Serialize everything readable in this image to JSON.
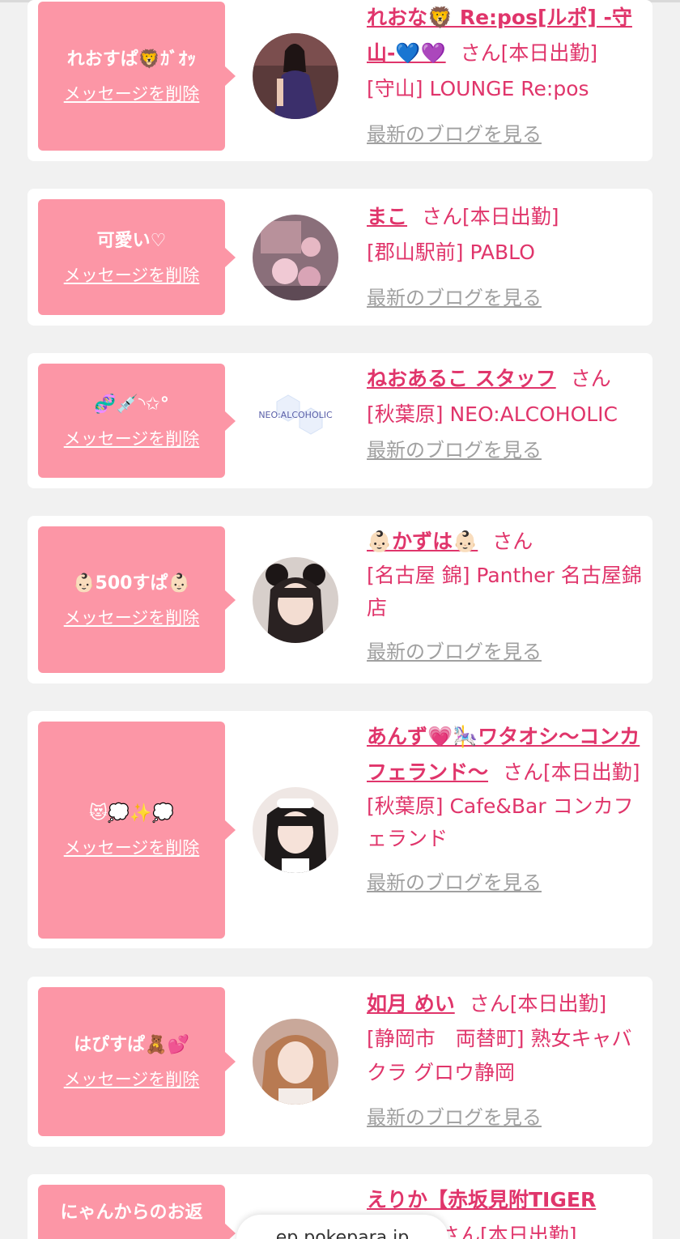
{
  "delete_label": "メッセージを削除",
  "blog_label": "最新のブログを見る",
  "san_label": "さん",
  "entries": [
    {
      "message": "れおすぱ🦁ｶﾞｵｯ",
      "name": "れおな🦁 Re:pos[ルポ] -守山-💙💜",
      "status": "[本日出勤]",
      "shop": "[守山] LOUNGE Re:pos"
    },
    {
      "message": "可愛い♡",
      "name": "まこ",
      "status": "[本日出勤]",
      "shop": "[郡山駅前] PABLO"
    },
    {
      "message": "🧬💉◝✩°",
      "name": "ねおあるこ スタッフ",
      "status": "",
      "shop": "[秋葉原] NEO:ALCOHOLIC",
      "avatar_text": "NEO:ALCOHOLIC"
    },
    {
      "message": "👶🏻500すぱ👶🏻",
      "name": "👶🏻かずは👶🏻",
      "status": "",
      "shop": "[名古屋 錦] Panther 名古屋錦店"
    },
    {
      "message": "😻💭✨💭",
      "name": "あんず💗🎠ワタオシ〜コンカフェランド〜",
      "status": "[本日出勤]",
      "shop": "[秋葉原] Cafe&Bar コンカフェランド"
    },
    {
      "message": "はぴすぱ🧸💕",
      "name": "如月 めい",
      "status": "[本日出勤]",
      "shop": "[静岡市　両替町] 熟女キャバクラ グロウ静岡"
    },
    {
      "message": "にゃんからのお返",
      "name": "えりか【赤坂見附TIGER",
      "status": "[本日出勤]",
      "shop": ""
    }
  ],
  "bottom_bar": {
    "domain_text": "ep.pokepara.jp"
  },
  "colors": {
    "accent": "#e0356b",
    "bubble": "#fc96a6",
    "link_gray": "#a0a0a0",
    "background": "#f1f1f1"
  }
}
